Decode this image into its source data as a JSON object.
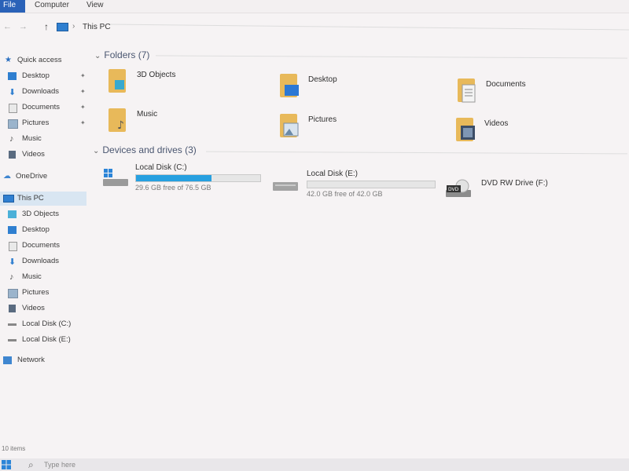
{
  "ribbon": {
    "tabs": [
      "File",
      "Computer",
      "View"
    ]
  },
  "address": {
    "crumb": "This PC"
  },
  "sidebar": {
    "items": [
      {
        "label": "Quick access",
        "icon": "star-icon"
      },
      {
        "label": "Desktop",
        "icon": "desktop-icon",
        "pinned": true
      },
      {
        "label": "Downloads",
        "icon": "download-icon",
        "pinned": true
      },
      {
        "label": "Documents",
        "icon": "documents-icon",
        "pinned": true
      },
      {
        "label": "Pictures",
        "icon": "pictures-icon",
        "pinned": true
      },
      {
        "label": "Music",
        "icon": "music-icon"
      },
      {
        "label": "Videos",
        "icon": "videos-icon"
      },
      {
        "label": "OneDrive",
        "icon": "cloud-icon"
      },
      {
        "label": "This PC",
        "icon": "computer-icon",
        "selected": true
      },
      {
        "label": "3D Objects",
        "icon": "cube-icon"
      },
      {
        "label": "Desktop",
        "icon": "desktop-icon"
      },
      {
        "label": "Documents",
        "icon": "documents-icon"
      },
      {
        "label": "Downloads",
        "icon": "download-icon"
      },
      {
        "label": "Music",
        "icon": "music-icon"
      },
      {
        "label": "Pictures",
        "icon": "pictures-icon"
      },
      {
        "label": "Videos",
        "icon": "videos-icon"
      },
      {
        "label": "Local Disk (C:)",
        "icon": "drive-icon"
      },
      {
        "label": "Local Disk (E:)",
        "icon": "drive-icon"
      },
      {
        "label": "Network",
        "icon": "network-icon"
      }
    ]
  },
  "folders": {
    "header": "Folders (7)",
    "items": [
      {
        "label": "3D Objects",
        "icon": "cube-folder-icon"
      },
      {
        "label": "Desktop",
        "icon": "desktop-folder-icon"
      },
      {
        "label": "Documents",
        "icon": "documents-folder-icon"
      },
      {
        "label": "Music",
        "icon": "music-folder-icon"
      },
      {
        "label": "Pictures",
        "icon": "pictures-folder-icon"
      },
      {
        "label": "Videos",
        "icon": "videos-folder-icon"
      }
    ]
  },
  "drives": {
    "header": "Devices and drives (3)",
    "items": [
      {
        "label": "Local Disk (C:)",
        "free": "29.6 GB free of 76.5 GB",
        "used_fraction": 0.61,
        "icon": "windows-drive-icon"
      },
      {
        "label": "Local Disk (E:)",
        "free": "42.0 GB free of 42.0 GB",
        "used_fraction": 0.0,
        "icon": "drive-icon"
      },
      {
        "label": "DVD RW Drive (F:)",
        "icon": "dvd-drive-icon"
      }
    ]
  },
  "status": {
    "items_text": "10 items"
  },
  "taskbar": {
    "search_text": "Type here"
  },
  "colors": {
    "accent": "#2a62b8",
    "bar_fill": "#27a0e0",
    "folder": "#e8b95a"
  }
}
